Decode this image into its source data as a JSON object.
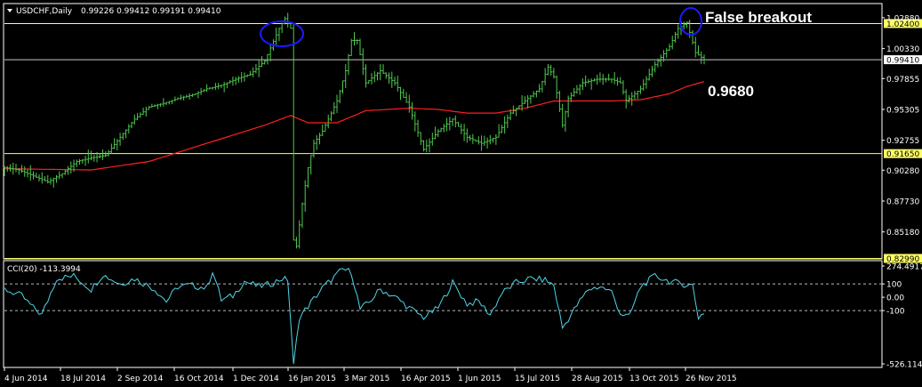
{
  "header": {
    "symbol": "USDCHF,Daily",
    "ohlc": "0.99226 0.99412 0.99191 0.99410",
    "menu_icon": "triangle-down-icon"
  },
  "indicator": {
    "label": "CCI(20) -113.3994"
  },
  "annotations": {
    "false_breakout": "False breakout",
    "level_ma": "0.9680"
  },
  "colors": {
    "background": "#000000",
    "candle": "#4fc94f",
    "moving_average": "#ff2020",
    "support_resistance": "#ffff66",
    "current_price": "#ffffff",
    "cci": "#4fd6e6",
    "ellipse": "#1a1aff",
    "axis": "#ffffff"
  },
  "chart_data": [
    {
      "type": "candlestick",
      "symbol": "USDCHF",
      "timeframe": "Daily",
      "x_tick_labels": [
        "4 Jun 2014",
        "18 Jul 2014",
        "2 Sep 2014",
        "16 Oct 2014",
        "1 Dec 2014",
        "16 Jan 2015",
        "3 Mar 2015",
        "16 Apr 2015",
        "1 Jun 2015",
        "15 Jul 2015",
        "28 Aug 2015",
        "13 Oct 2015",
        "26 Nov 2015"
      ],
      "y_tick_labels": [
        "1.02880",
        "1.00330",
        "0.97855",
        "0.95305",
        "0.92755",
        "0.90280",
        "0.87730",
        "0.85180"
      ],
      "ylim": [
        0.8295,
        1.0405
      ],
      "price_levels": [
        {
          "label": "1.02400",
          "value": 1.024,
          "kind": "horizontal-line"
        },
        {
          "label": "0.99410",
          "value": 0.9941,
          "kind": "current-price"
        },
        {
          "label": "0.91650",
          "value": 0.9165,
          "kind": "horizontal-line"
        },
        {
          "label": "0.82990",
          "value": 0.8299,
          "kind": "horizontal-line"
        }
      ],
      "close_path": [
        [
          0,
          0.905
        ],
        [
          5,
          0.903
        ],
        [
          10,
          0.898
        ],
        [
          15,
          0.893
        ],
        [
          20,
          0.9
        ],
        [
          25,
          0.91
        ],
        [
          30,
          0.913
        ],
        [
          35,
          0.915
        ],
        [
          40,
          0.93
        ],
        [
          45,
          0.945
        ],
        [
          50,
          0.955
        ],
        [
          55,
          0.958
        ],
        [
          60,
          0.962
        ],
        [
          65,
          0.965
        ],
        [
          70,
          0.97
        ],
        [
          75,
          0.973
        ],
        [
          80,
          0.978
        ],
        [
          85,
          0.982
        ],
        [
          90,
          0.993
        ],
        [
          95,
          1.02
        ],
        [
          97,
          1.028
        ],
        [
          99,
          1.02
        ],
        [
          100,
          0.845
        ],
        [
          101,
          0.84
        ],
        [
          103,
          0.875
        ],
        [
          105,
          0.905
        ],
        [
          107,
          0.925
        ],
        [
          110,
          0.935
        ],
        [
          115,
          0.96
        ],
        [
          118,
          0.985
        ],
        [
          120,
          1.01
        ],
        [
          122,
          1.01
        ],
        [
          125,
          0.975
        ],
        [
          130,
          0.985
        ],
        [
          135,
          0.975
        ],
        [
          140,
          0.955
        ],
        [
          145,
          0.92
        ],
        [
          150,
          0.935
        ],
        [
          155,
          0.945
        ],
        [
          160,
          0.93
        ],
        [
          165,
          0.925
        ],
        [
          170,
          0.93
        ],
        [
          175,
          0.95
        ],
        [
          180,
          0.96
        ],
        [
          185,
          0.97
        ],
        [
          188,
          0.988
        ],
        [
          190,
          0.98
        ],
        [
          193,
          0.94
        ],
        [
          195,
          0.962
        ],
        [
          200,
          0.975
        ],
        [
          205,
          0.978
        ],
        [
          210,
          0.978
        ],
        [
          213,
          0.975
        ],
        [
          215,
          0.96
        ],
        [
          220,
          0.97
        ],
        [
          225,
          0.99
        ],
        [
          230,
          1.005
        ],
        [
          233,
          1.02
        ],
        [
          236,
          1.025
        ],
        [
          239,
          1.0
        ],
        [
          242,
          0.9941
        ]
      ],
      "moving_average_path": [
        [
          0,
          0.904
        ],
        [
          30,
          0.903
        ],
        [
          50,
          0.91
        ],
        [
          70,
          0.925
        ],
        [
          90,
          0.94
        ],
        [
          99,
          0.948
        ],
        [
          105,
          0.942
        ],
        [
          115,
          0.942
        ],
        [
          125,
          0.952
        ],
        [
          140,
          0.954
        ],
        [
          150,
          0.953
        ],
        [
          160,
          0.95
        ],
        [
          170,
          0.95
        ],
        [
          180,
          0.954
        ],
        [
          190,
          0.96
        ],
        [
          200,
          0.96
        ],
        [
          210,
          0.96
        ],
        [
          220,
          0.961
        ],
        [
          230,
          0.966
        ],
        [
          236,
          0.972
        ],
        [
          242,
          0.976
        ]
      ]
    },
    {
      "type": "line",
      "name": "CCI(20)",
      "x_tick_labels": [
        "4 Jun 2014",
        "18 Jul 2014",
        "2 Sep 2014",
        "16 Oct 2014",
        "1 Dec 2014",
        "16 Jan 2015",
        "3 Mar 2015",
        "16 Apr 2015",
        "1 Jun 2015",
        "15 Jul 2015",
        "28 Aug 2015",
        "13 Oct 2015",
        "26 Nov 2015"
      ],
      "y_tick_labels": [
        "274.4917",
        "100",
        "0.00",
        "-100",
        "-526.1143"
      ],
      "levels": [
        100,
        0,
        -100
      ],
      "ylim": [
        -526.1143,
        274.4917
      ],
      "path": [
        [
          0,
          60
        ],
        [
          6,
          10
        ],
        [
          10,
          -80
        ],
        [
          13,
          -130
        ],
        [
          18,
          140
        ],
        [
          24,
          160
        ],
        [
          30,
          60
        ],
        [
          34,
          170
        ],
        [
          40,
          100
        ],
        [
          45,
          140
        ],
        [
          52,
          60
        ],
        [
          56,
          -30
        ],
        [
          60,
          80
        ],
        [
          64,
          90
        ],
        [
          70,
          70
        ],
        [
          72,
          200
        ],
        [
          75,
          -20
        ],
        [
          79,
          10
        ],
        [
          83,
          120
        ],
        [
          88,
          80
        ],
        [
          92,
          100
        ],
        [
          96,
          140
        ],
        [
          98,
          130
        ],
        [
          100,
          -500
        ],
        [
          102,
          -150
        ],
        [
          106,
          -40
        ],
        [
          110,
          70
        ],
        [
          114,
          150
        ],
        [
          117,
          210
        ],
        [
          120,
          190
        ],
        [
          123,
          -90
        ],
        [
          126,
          -40
        ],
        [
          130,
          60
        ],
        [
          136,
          -10
        ],
        [
          140,
          -80
        ],
        [
          145,
          -150
        ],
        [
          150,
          -80
        ],
        [
          155,
          110
        ],
        [
          160,
          -50
        ],
        [
          164,
          -30
        ],
        [
          168,
          -130
        ],
        [
          172,
          30
        ],
        [
          177,
          110
        ],
        [
          182,
          140
        ],
        [
          187,
          130
        ],
        [
          190,
          90
        ],
        [
          193,
          -230
        ],
        [
          198,
          -60
        ],
        [
          202,
          60
        ],
        [
          206,
          80
        ],
        [
          210,
          40
        ],
        [
          213,
          -120
        ],
        [
          216,
          -150
        ],
        [
          220,
          80
        ],
        [
          225,
          160
        ],
        [
          230,
          120
        ],
        [
          234,
          100
        ],
        [
          238,
          90
        ],
        [
          240,
          -150
        ],
        [
          242,
          -113.4
        ]
      ]
    }
  ]
}
